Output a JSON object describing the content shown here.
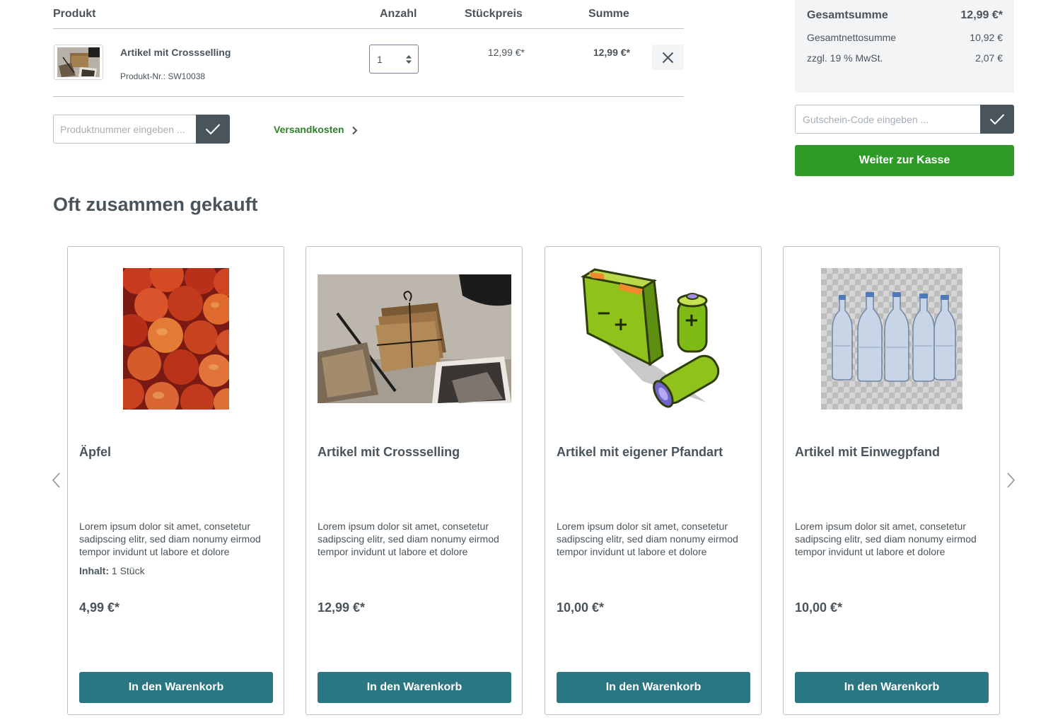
{
  "cart": {
    "headers": {
      "product": "Produkt",
      "quantity": "Anzahl",
      "unit_price": "Stückpreis",
      "total": "Summe"
    },
    "items": [
      {
        "name": "Artikel mit Crossselling",
        "sku": "Produkt-Nr.: SW10038",
        "quantity": "1",
        "unit_price": "12,99 €*",
        "total": "12,99 €*",
        "image_icon": "vintage-photos-image"
      }
    ],
    "product_number_input": {
      "placeholder": "Produktnummer eingeben ...",
      "value": ""
    },
    "shipping_link": "Versandkosten"
  },
  "summary": {
    "total_label": "Gesamtsumme",
    "total_value": "12,99 €*",
    "net_label": "Gesamtnettosumme",
    "net_value": "10,92 €",
    "tax_label": "zzgl. 19 % MwSt.",
    "tax_value": "2,07 €",
    "voucher_input": {
      "placeholder": "Gutschein-Code eingeben ...",
      "value": ""
    },
    "checkout_button": "Weiter zur Kasse"
  },
  "cross_selling": {
    "title": "Oft zusammen gekauft",
    "cards": [
      {
        "name": "Äpfel",
        "description": "Lorem ipsum dolor sit amet, consetetur sadipscing elitr, sed diam nonumy eirmod tempor invidunt ut labore et dolore",
        "content_label": "Inhalt:",
        "content_value": "1 Stück",
        "price": "4,99 €*",
        "button": "In den Warenkorb",
        "image_icon": "apples-image"
      },
      {
        "name": "Artikel mit Crossselling",
        "description": "Lorem ipsum dolor sit amet, consetetur sadipscing elitr, sed diam nonumy eirmod tempor invidunt ut labore et dolore",
        "price": "12,99 €*",
        "button": "In den Warenkorb",
        "image_icon": "vintage-photos-image"
      },
      {
        "name": "Artikel mit eigener Pfandart",
        "description": "Lorem ipsum dolor sit amet, consetetur sadipscing elitr, sed diam nonumy eirmod tempor invidunt ut labore et dolore",
        "price": "10,00 €*",
        "button": "In den Warenkorb",
        "image_icon": "batteries-image"
      },
      {
        "name": "Artikel mit Einwegpfand",
        "description": "Lorem ipsum dolor sit amet, consetetur sadipscing elitr, sed diam nonumy eirmod tempor invidunt ut labore et dolore",
        "price": "10,00 €*",
        "button": "In den Warenkorb",
        "image_icon": "water-bottles-image"
      }
    ]
  },
  "colors": {
    "text": "#4a545b",
    "primary_green": "#2f9a28",
    "link_green": "#2f7f2a",
    "buy_button": "#2b7683",
    "dark_button": "#4a545b",
    "summary_bg": "#f3f4f5"
  }
}
